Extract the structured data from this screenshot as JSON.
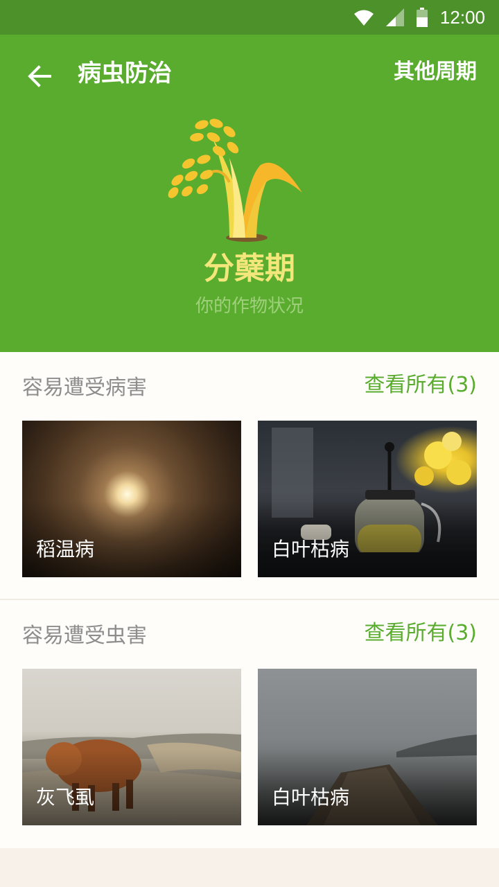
{
  "status_bar": {
    "time": "12:00"
  },
  "header": {
    "title": "病虫防治",
    "other_periods_label": "其他周期",
    "stage_name": "分蘖期",
    "stage_subtitle": "你的作物状况"
  },
  "disease_section": {
    "title": "容易遭受病害",
    "view_all_label": "查看所有(3)",
    "cards": [
      {
        "label": "稻温病"
      },
      {
        "label": "白叶枯病"
      }
    ]
  },
  "pest_section": {
    "title": "容易遭受虫害",
    "view_all_label": "查看所有(3)",
    "cards": [
      {
        "label": "灰飞虱"
      },
      {
        "label": "白叶枯病"
      }
    ]
  },
  "colors": {
    "primary_green": "#5aac2f",
    "status_bar_green": "#4d912a",
    "stage_yellow": "#f3e67a"
  }
}
